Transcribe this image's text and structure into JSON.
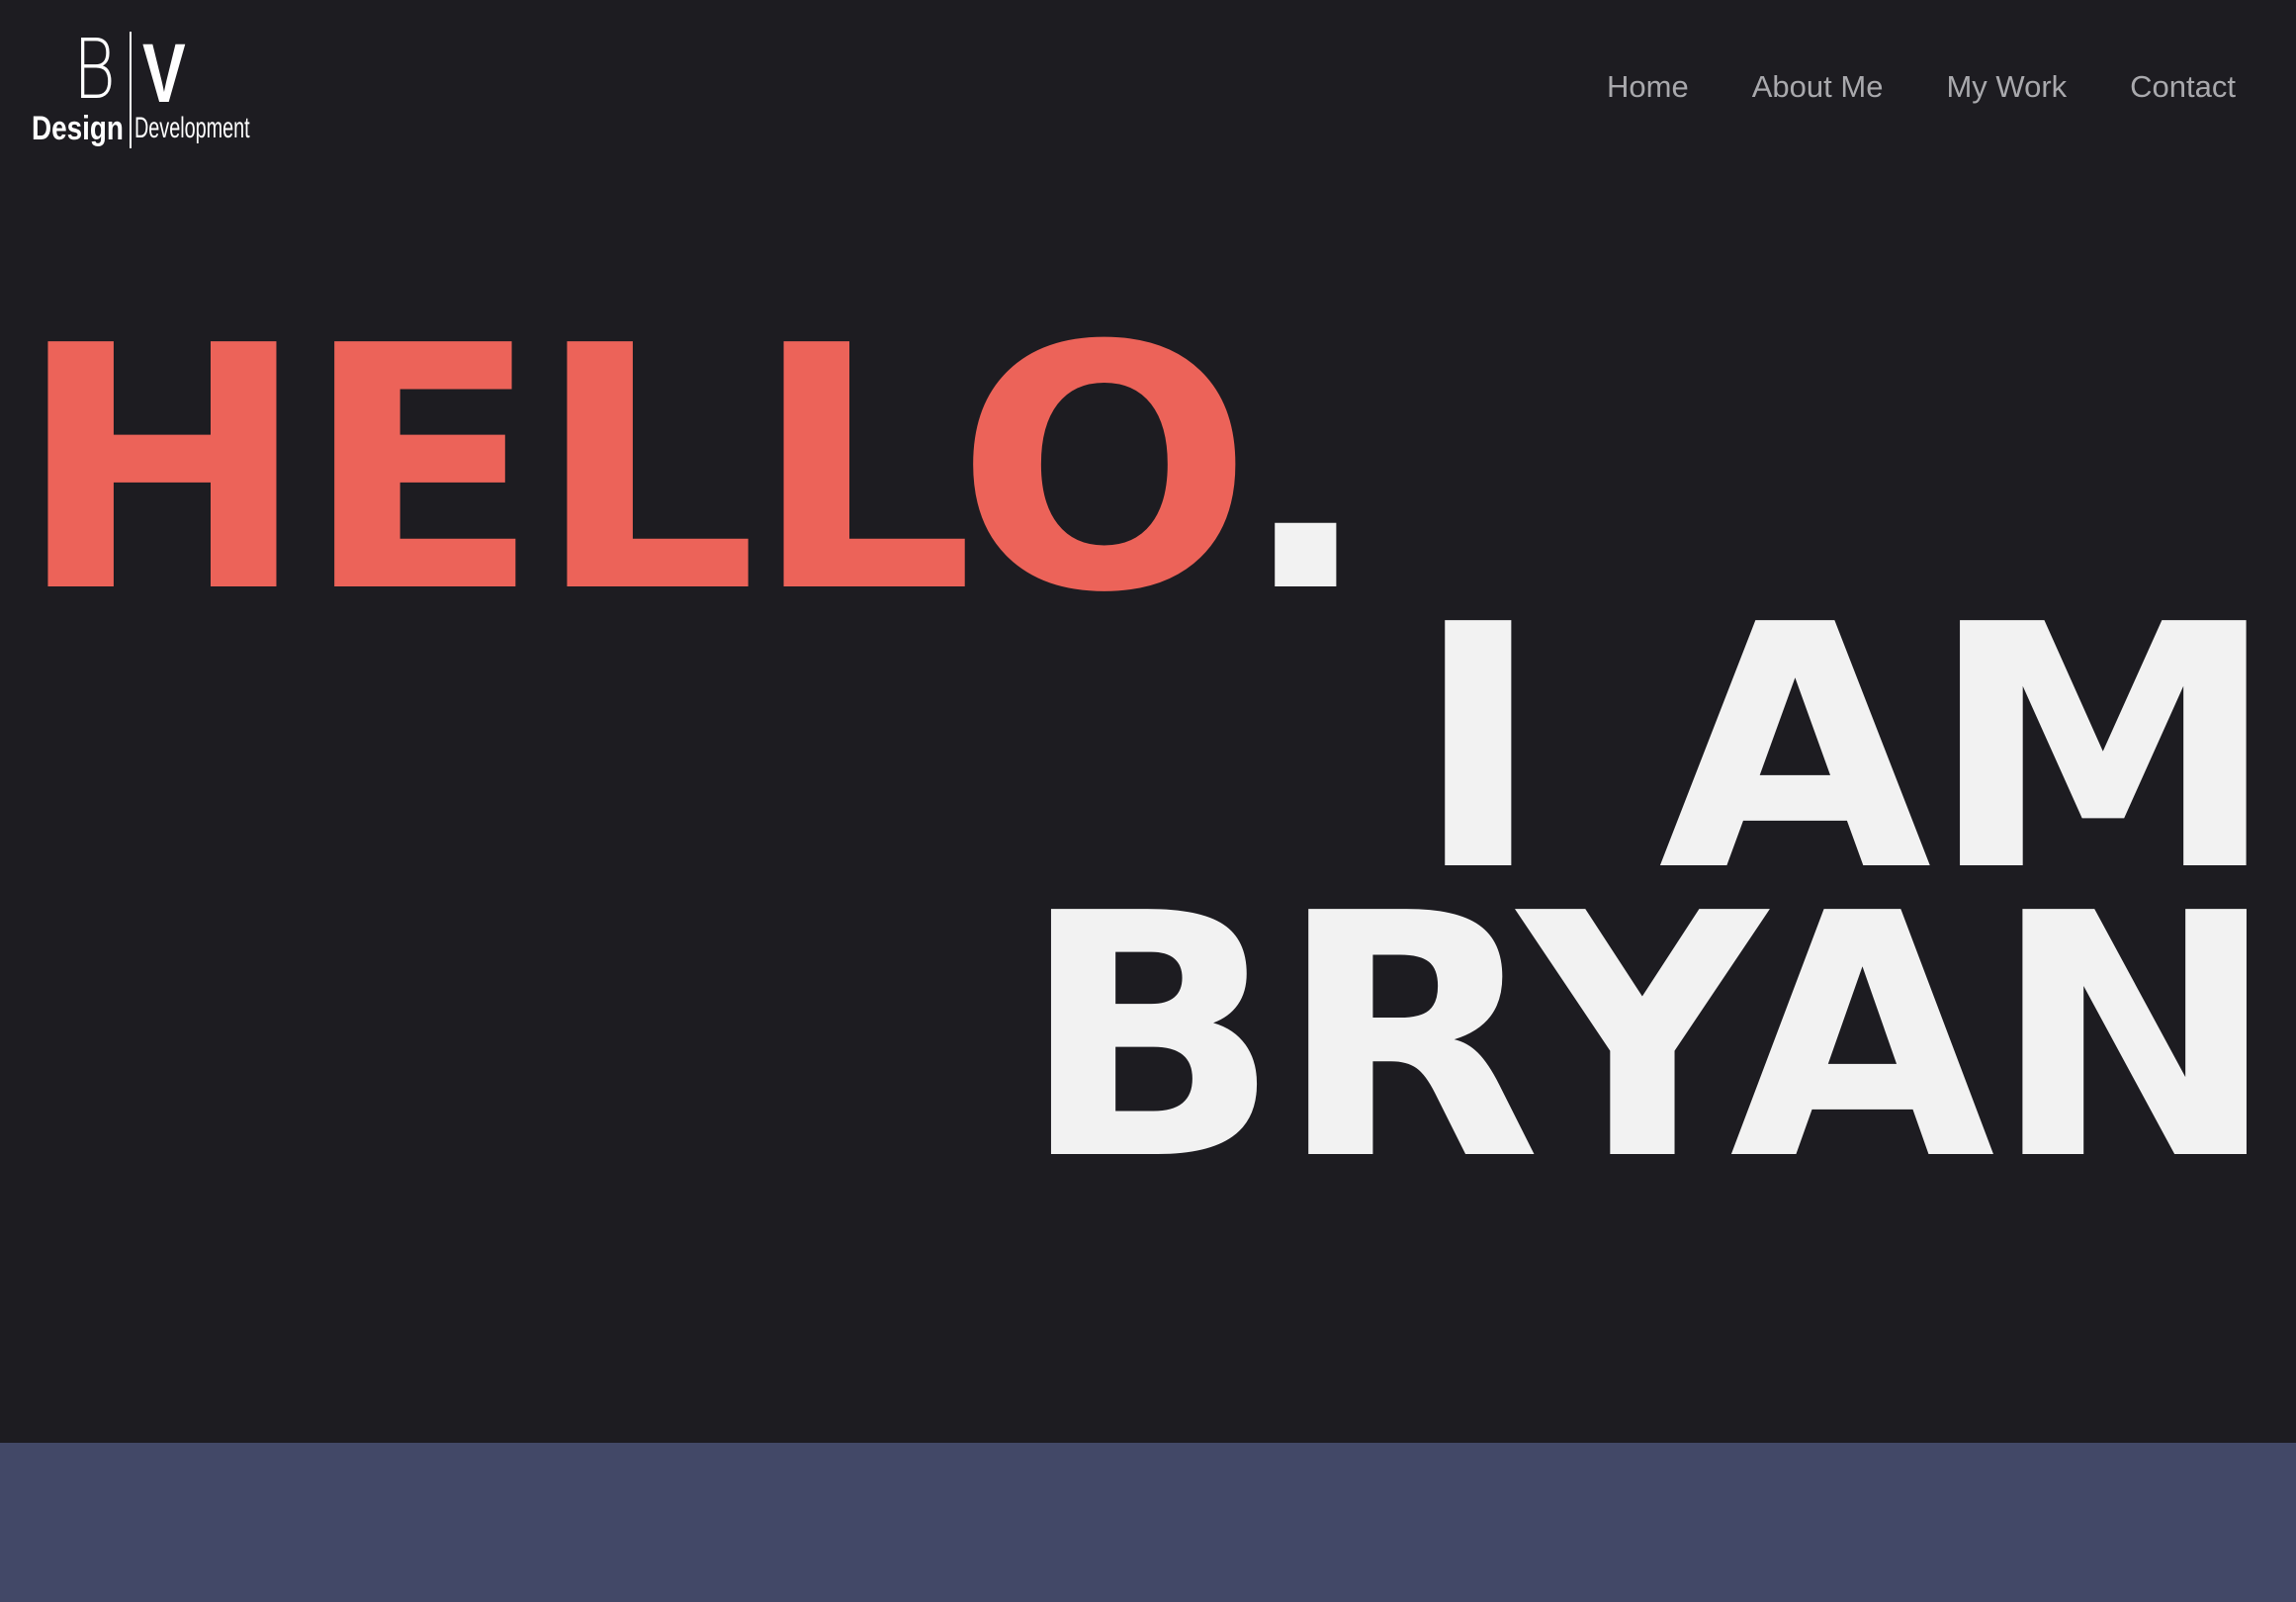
{
  "logo": {
    "letter_b": "B",
    "letter_v": "V",
    "word_design": "Design",
    "word_development": "Development"
  },
  "nav": {
    "items": [
      {
        "label": "Home"
      },
      {
        "label": "About Me"
      },
      {
        "label": "My Work"
      },
      {
        "label": "Contact"
      }
    ]
  },
  "hero": {
    "hello": "HELLO",
    "period": ".",
    "line_two": "I AM",
    "line_three": "BRYAN"
  },
  "colors": {
    "background": "#1d1c21",
    "accent": "#ec6359",
    "headline": "#f2f2f2",
    "nav_text": "#a9a9ad",
    "lower_band": "#424867"
  }
}
